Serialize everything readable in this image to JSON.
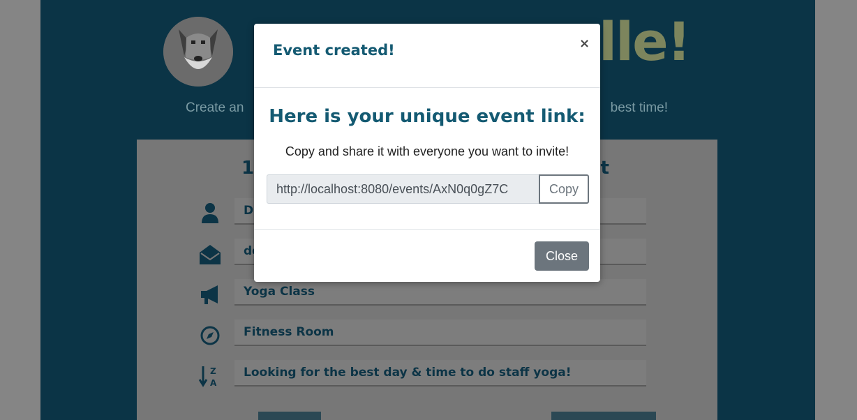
{
  "background": {
    "brand_visible": "lle!",
    "tagline_left": "Create an",
    "tagline_right": "best time!",
    "panel_heading_left": "1",
    "panel_heading_right": "nt",
    "fields": [
      {
        "icon": "user-icon",
        "value": "D"
      },
      {
        "icon": "envelope-icon",
        "value": "de"
      },
      {
        "icon": "megaphone-icon",
        "value": "Yoga Class"
      },
      {
        "icon": "compass-icon",
        "value": "Fitness Room"
      },
      {
        "icon": "sort-z-a-icon",
        "value": "Looking for the best day & time to do staff yoga!"
      }
    ]
  },
  "modal": {
    "title": "Event created!",
    "close_symbol": "×",
    "heading": "Here is your unique event link:",
    "subtext": "Copy and share it with everyone you want to invite!",
    "link_value": "http://localhost:8080/events/AxN0q0gZ7C",
    "copy_label": "Copy",
    "close_label": "Close"
  },
  "colors": {
    "modal_title": "#145a72",
    "overlay": "#858585",
    "page_dark": "#0b3446",
    "brand": "#7d855d"
  }
}
